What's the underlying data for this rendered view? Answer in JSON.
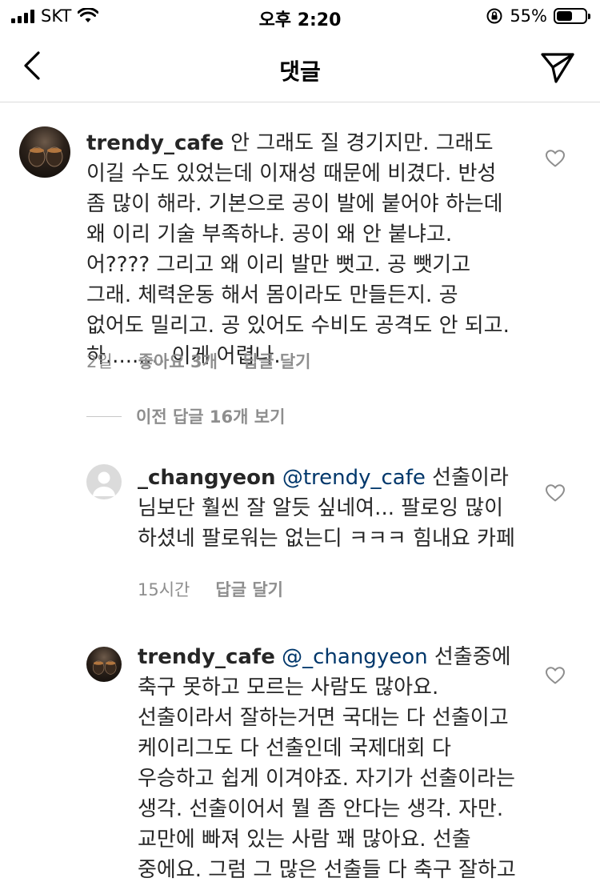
{
  "status_bar": {
    "carrier": "SKT",
    "time": "오후 2:20",
    "battery_percent": "55%",
    "battery_level": 0.55,
    "icons": [
      "signal-icon",
      "wifi-icon",
      "orientation-lock-icon",
      "battery-icon"
    ]
  },
  "nav": {
    "title": "댓글",
    "back_icon": "chevron-left-icon",
    "send_icon": "paper-plane-icon"
  },
  "comments": [
    {
      "username": "trendy_cafe",
      "mention": "",
      "text": " 안 그래도 질 경기지만. 그래도 이길 수도 있었는데 이재성 때문에 비겼다. 반성 좀 많이 해라. 기본으로 공이 발에 붙어야 하는데 왜 이리 기술 부족하냐. 공이 왜 안 붙냐고. 어???? 그리고 왜 이리 발만 뻣고. 공 뺏기고 그래. 체력운동 해서 몸이라도 만들든지. 공 없어도 밀리고. 공 있어도 수비도 공격도 안 되고. 하......... 이게 어렵나.",
      "time": "2일",
      "likes": "좋아요 3개",
      "reply": "답글 달기"
    },
    {
      "username": "_changyeon",
      "mention": "@trendy_cafe",
      "text": " 선출이라 님보단 훨씬 잘 알듯 싶네여... 팔로잉 많이 하셨네 팔로워는 없는디 ㅋㅋㅋ 힘내요 카페",
      "time": "15시간",
      "reply": "답글 달기"
    },
    {
      "username": "trendy_cafe",
      "mention": "@_changyeon",
      "text": " 선출중에 축구 못하고 모르는 사람도 많아요. 선출이라서 잘하는거면 국대는 다 선출이고 케이리그도 다 선출인데 국제대회 다 우승하고 쉽게 이겨야죠. 자기가 선출이라는 생각. 선출이어서 뭘 좀 안다는 생각. 자만. 교만에 빠져 있는 사람 꽤 많아요. 선출 중에요. 그럼 그 많은 선출들 다 축구 잘하고 대한민국 축구 수준 그리 높게요."
    }
  ],
  "view_replies": "이전 답글 16개 보기"
}
